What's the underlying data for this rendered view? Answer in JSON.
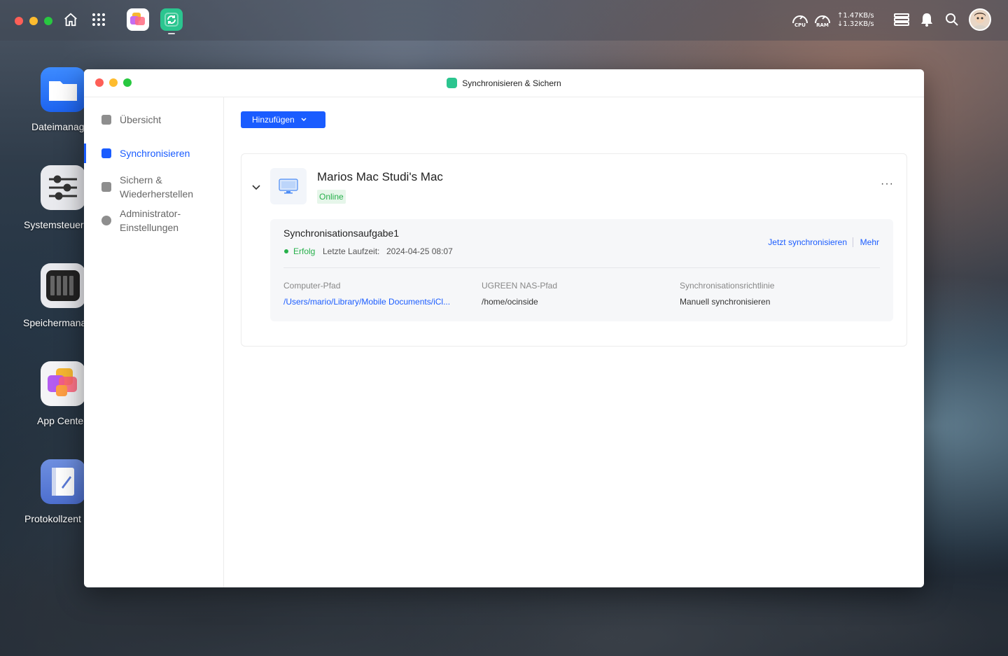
{
  "topbar": {
    "cpu_label": "CPU",
    "ram_label": "RAM",
    "upload_speed": "↑1.47KB/s",
    "download_speed": "↓1.32KB/s"
  },
  "desktop": {
    "items": [
      {
        "label": "Dateimanag"
      },
      {
        "label": "Systemsteuer"
      },
      {
        "label": "Speichermana"
      },
      {
        "label": "App Cente"
      },
      {
        "label": "Protokollzent"
      }
    ]
  },
  "window": {
    "title": "Synchronisieren & Sichern",
    "sidebar": {
      "items": [
        {
          "label": "Übersicht"
        },
        {
          "label": "Synchronisieren"
        },
        {
          "label": "Sichern &\nWiederherstellen",
          "line1": "Sichern &",
          "line2": "Wiederherstellen"
        },
        {
          "label": "Administrator-\nEinstellungen",
          "line1": "Administrator-",
          "line2": "Einstellungen"
        }
      ],
      "active_index": 1
    },
    "main": {
      "add_button": "Hinzufügen",
      "device": {
        "name": "Marios Mac Studi's Mac",
        "status": "Online"
      },
      "task": {
        "name": "Synchronisationsaufgabe1",
        "status": "Erfolg",
        "last_run_label": "Letzte Laufzeit:",
        "last_run_value": "2024-04-25 08:07",
        "sync_now": "Jetzt synchronisieren",
        "more": "Mehr",
        "computer_path_label": "Computer-Pfad",
        "computer_path_value": "/Users/mario/Library/Mobile Documents/iCl...",
        "nas_path_label": "UGREEN NAS-Pfad",
        "nas_path_value": "/home/ocinside",
        "policy_label": "Synchronisationsrichtlinie",
        "policy_value": "Manuell synchronisieren"
      }
    }
  },
  "colors": {
    "accent": "#1a5cff",
    "success": "#27b04b"
  }
}
